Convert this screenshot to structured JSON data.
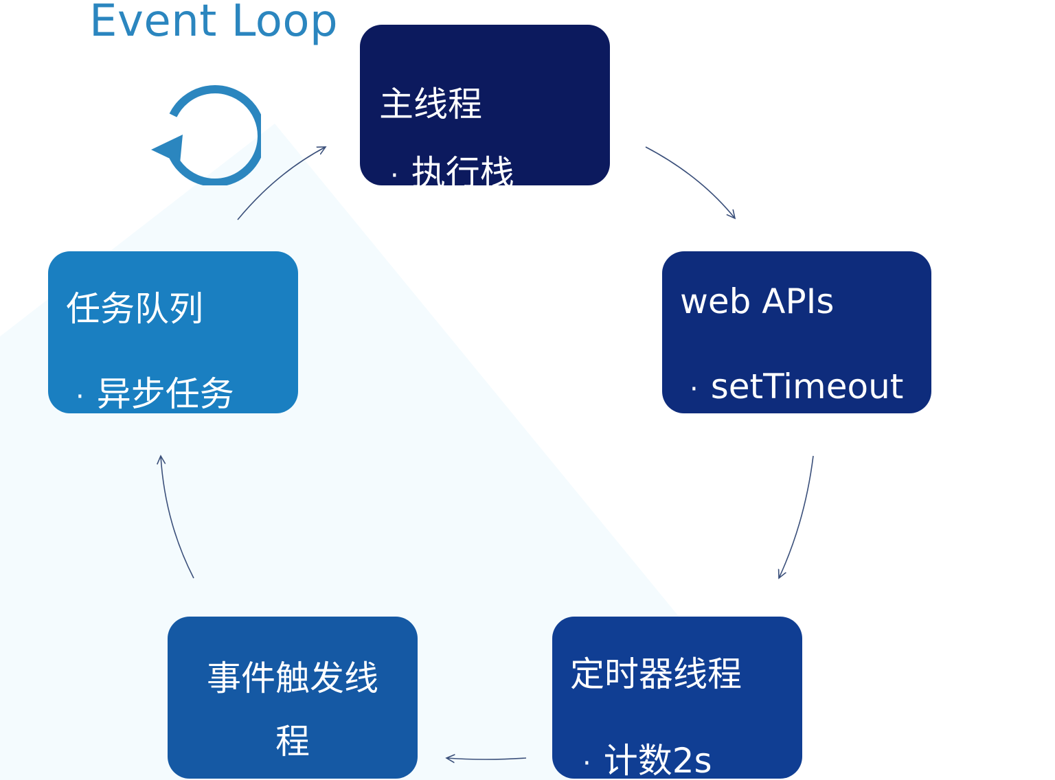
{
  "title": "Event Loop",
  "icon": "refresh-cycle-icon",
  "colors": {
    "title": "#2b86bf",
    "main_thread": "#0c1a5e",
    "web_apis": "#0e2c7c",
    "timer_thread": "#103e93",
    "event_thread": "#1559a4",
    "task_queue": "#1a7fc1",
    "arrow": "#3a4f7a"
  },
  "nodes": {
    "main_thread": {
      "heading": "主线程",
      "bullet": "·",
      "item": "执行栈"
    },
    "web_apis": {
      "heading": "web APIs",
      "bullet": "·",
      "item": "setTimeout"
    },
    "timer_thread": {
      "heading": "定时器线程",
      "bullet": "·",
      "item": "计数2s"
    },
    "event_thread": {
      "heading": "事件触发线程"
    },
    "task_queue": {
      "heading": "任务队列",
      "bullet": "·",
      "item": "异步任务"
    }
  }
}
